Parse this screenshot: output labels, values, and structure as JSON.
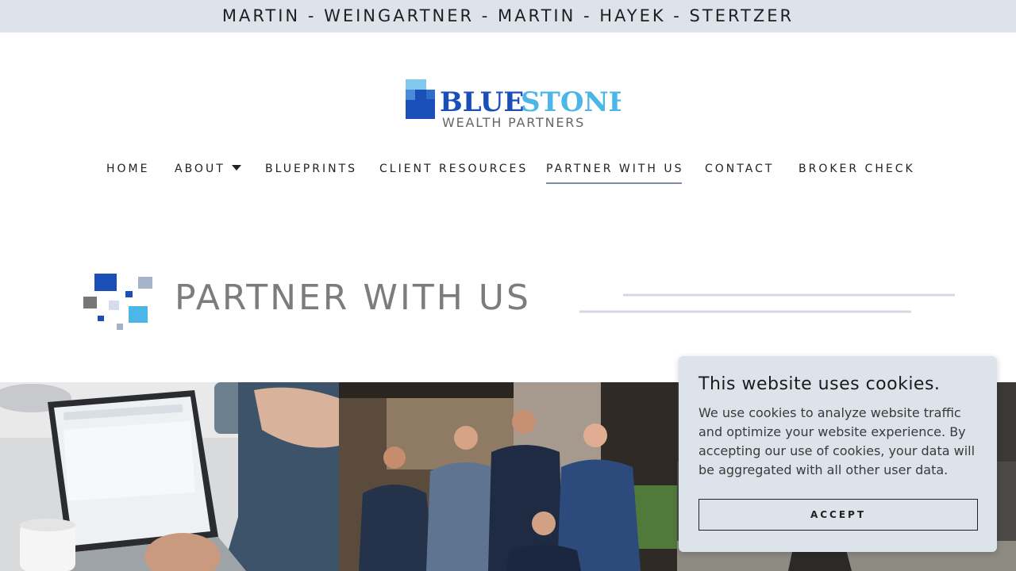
{
  "top_bar": {
    "text": "MARTIN - WEINGARTNER - MARTIN - HAYEK - STERTZER",
    "background": "#dde3ea"
  },
  "logo": {
    "name_part1": "BLUE",
    "name_part2": "STONE",
    "subtitle": "WEALTH PARTNERS",
    "colors": {
      "primary": "#1b4fb8",
      "accent": "#4cb6e8",
      "subtitle": "#666666"
    }
  },
  "nav": {
    "items": [
      {
        "label": "HOME",
        "active": false
      },
      {
        "label": "ABOUT",
        "active": false,
        "has_dropdown": true
      },
      {
        "label": "BLUEPRINTS",
        "active": false
      },
      {
        "label": "CLIENT RESOURCES",
        "active": false
      },
      {
        "label": "PARTNER WITH US",
        "active": true
      },
      {
        "label": "CONTACT",
        "active": false
      },
      {
        "label": "BROKER CHECK",
        "active": false
      }
    ],
    "dropdown_icon": "caret-down-icon"
  },
  "banner": {
    "title": "PARTNER WITH US",
    "title_color": "#7c7c7c"
  },
  "photos": [
    {
      "subject": "hands typing on laptop with mug"
    },
    {
      "subject": "five men in suits group portrait"
    },
    {
      "subject": "office interior with statue"
    }
  ],
  "cookie_banner": {
    "title": "This website uses cookies.",
    "body": "We use cookies to analyze website traffic and optimize your website experience. By accepting our use of cookies, your data will be aggregated with all other user data.",
    "accept_label": "ACCEPT",
    "background": "#dde3ea"
  }
}
